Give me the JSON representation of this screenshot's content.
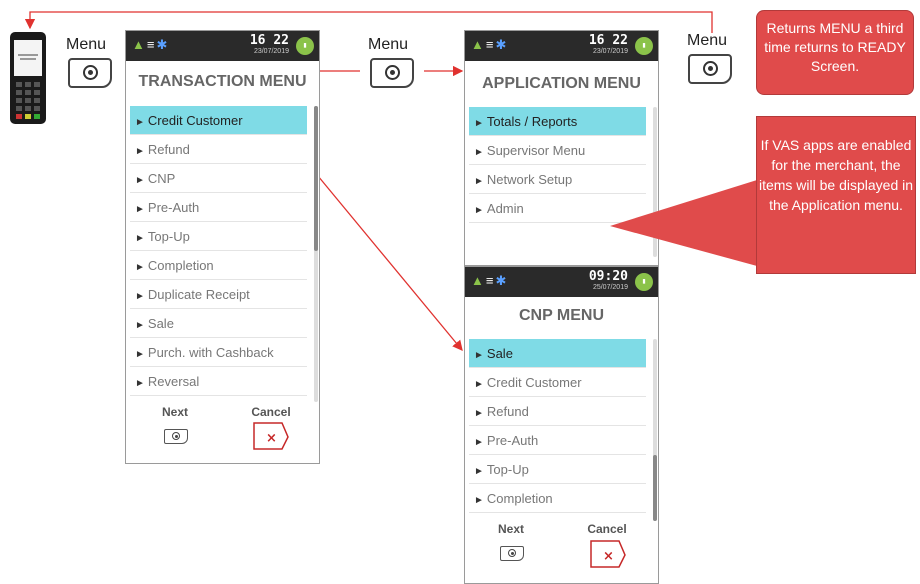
{
  "menu_key_label": "Menu",
  "screens": {
    "transaction": {
      "title": "TRANSACTION MENU",
      "time": "16 22",
      "date": "23/07/2019",
      "items": [
        "Credit Customer",
        "Refund",
        "CNP",
        "Pre-Auth",
        "Top-Up",
        "Completion",
        "Duplicate Receipt",
        "Sale",
        "Purch. with Cashback",
        "Reversal"
      ],
      "selected_index": 0,
      "next_label": "Next",
      "cancel_label": "Cancel"
    },
    "application": {
      "title": "APPLICATION MENU",
      "time": "16 22",
      "date": "23/07/2019",
      "items": [
        "Totals / Reports",
        "Supervisor Menu",
        "Network Setup",
        "Admin"
      ],
      "selected_index": 0
    },
    "cnp": {
      "title": "CNP MENU",
      "time": "09:20",
      "date": "25/07/2019",
      "items": [
        "Sale",
        "Credit Customer",
        "Refund",
        "Pre-Auth",
        "Top-Up",
        "Completion"
      ],
      "selected_index": 0,
      "next_label": "Next",
      "cancel_label": "Cancel"
    }
  },
  "callouts": {
    "top": "Returns MENU a third time  returns to READY Screen.",
    "side": "If VAS apps are enabled for the merchant, the items will be displayed in the Application menu."
  },
  "colors": {
    "arrow": "#e0322f",
    "highlight": "#7fdbe6",
    "callout": "#e04b4b",
    "status_bar": "#2a2a2a",
    "battery": "#8bc34a"
  },
  "icons": [
    "terminal-device-icon",
    "menu-key-icon",
    "wifi-icon",
    "bluetooth-icon",
    "signal-icon",
    "battery-icon",
    "next-key-icon",
    "cancel-key-icon"
  ]
}
